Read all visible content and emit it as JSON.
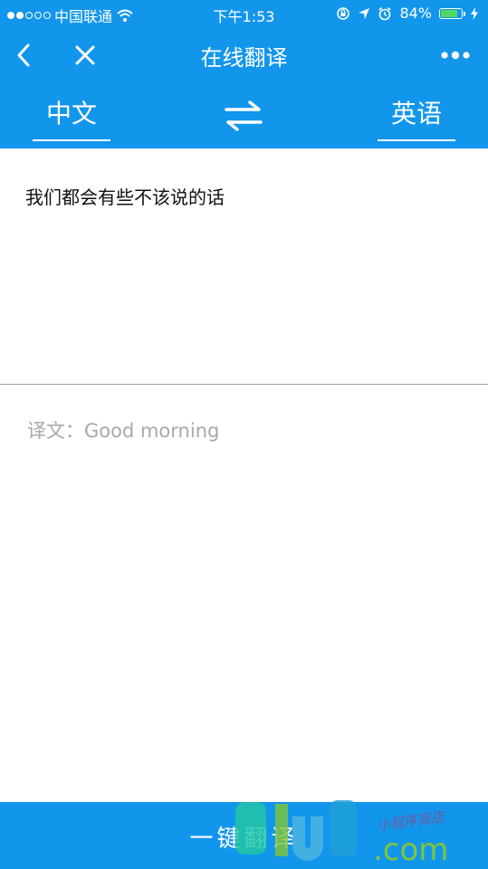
{
  "status_bar": {
    "carrier": "中国联通",
    "time": "下午1:53",
    "battery": "84%",
    "battery_level": 0.84
  },
  "nav": {
    "title": "在线翻译",
    "back_icon": "chevron-left-icon",
    "close_icon": "close-icon",
    "more_icon": "more-dots-icon"
  },
  "language": {
    "source": "中文",
    "target": "英语",
    "swap_icon": "swap-arrows-icon"
  },
  "input": {
    "text": "我们都会有些不该说的话"
  },
  "result": {
    "label": "译文：",
    "text": "Good morning"
  },
  "action": {
    "translate_label": "一键翻译"
  },
  "watermark": {
    "text": "9lud.com",
    "handwritten": "小程序商店"
  },
  "colors": {
    "primary": "#1296ec",
    "result_text": "#a8a8a8",
    "battery_green": "#4cd964"
  }
}
